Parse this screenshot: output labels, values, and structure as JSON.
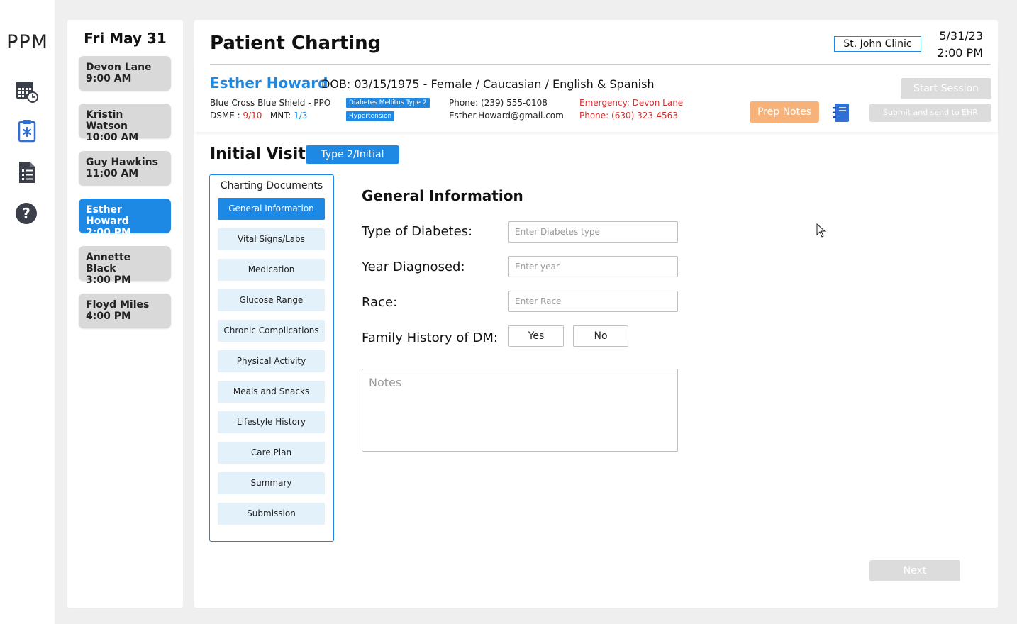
{
  "app": {
    "logo": "PPM"
  },
  "rail": {
    "icons": [
      "calendar-clock-icon",
      "clipboard-medical-icon",
      "document-list-icon",
      "help-icon"
    ]
  },
  "schedule": {
    "date": "Fri May 31",
    "appointments": [
      {
        "name": "Devon Lane",
        "time": "9:00 AM",
        "active": false
      },
      {
        "name": "Kristin Watson",
        "time": "10:00 AM",
        "active": false
      },
      {
        "name": "Guy Hawkins",
        "time": "11:00 AM",
        "active": false
      },
      {
        "name": "Esther Howard",
        "time": "2:00 PM",
        "active": true
      },
      {
        "name": "Annette Black",
        "time": "3:00 PM",
        "active": false
      },
      {
        "name": "Floyd Miles",
        "time": "4:00 PM",
        "active": false
      }
    ]
  },
  "header": {
    "title": "Patient Charting",
    "clinic": "St. John Clinic",
    "date": "5/31/23",
    "time": "2:00 PM"
  },
  "patient": {
    "name": "Esther Howard",
    "demographics": "DOB: 03/15/1975  -  Female / Caucasian / English & Spanish",
    "insurance": "Blue Cross Blue Shield - PPO",
    "dsme_label": "DSME : ",
    "dsme_value": "9/10",
    "mnt_label": "MNT: ",
    "mnt_value": "1/3",
    "tags": [
      "Diabetes Mellitus Type 2",
      "Hypertension"
    ],
    "phone": "Phone: (239) 555-0108",
    "email": "Esther.Howard@gmail.com",
    "emergency": "Emergency: Devon Lane",
    "emergency_phone": "Phone: (630) 323-4563"
  },
  "actions": {
    "start_session": "Start Session",
    "prep_notes": "Prep Notes",
    "submit": "Submit and send to EHR",
    "next": "Next"
  },
  "visit": {
    "title": "Initial Visit",
    "badge": "Type 2/Initial"
  },
  "documents": {
    "title": "Charting Documents",
    "items": [
      {
        "label": "General Information",
        "active": true
      },
      {
        "label": "Vital Signs/Labs",
        "active": false
      },
      {
        "label": "Medication",
        "active": false
      },
      {
        "label": "Glucose Range",
        "active": false
      },
      {
        "label": "Chronic Complications",
        "active": false
      },
      {
        "label": "Physical Activity",
        "active": false
      },
      {
        "label": "Meals and Snacks",
        "active": false
      },
      {
        "label": "Lifestyle History",
        "active": false
      },
      {
        "label": "Care Plan",
        "active": false
      },
      {
        "label": "Summary",
        "active": false
      },
      {
        "label": "Submission",
        "active": false
      }
    ]
  },
  "form": {
    "title": "General Information",
    "diabetes_type": {
      "label": "Type of Diabetes:",
      "value": "",
      "placeholder": "Enter Diabetes type"
    },
    "year_diagnosed": {
      "label": "Year Diagnosed:",
      "value": "",
      "placeholder": "Enter year"
    },
    "race": {
      "label": "Race:",
      "value": "",
      "placeholder": "Enter Race"
    },
    "family_history": {
      "label": "Family History of DM:",
      "yes": "Yes",
      "no": "No"
    },
    "notes": {
      "placeholder": "Notes",
      "value": ""
    }
  },
  "colors": {
    "accent": "#1e88e5",
    "prep": "#f7b27a",
    "alert": "#d32f2f",
    "disabled": "#dcdcdc"
  }
}
